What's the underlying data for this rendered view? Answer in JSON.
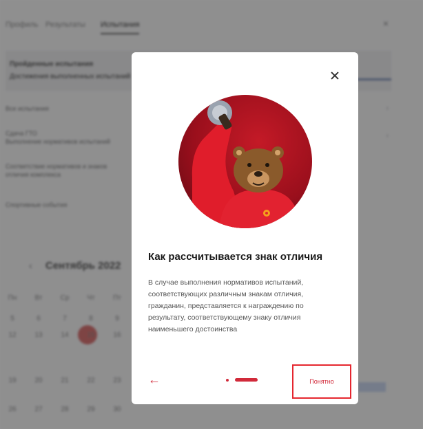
{
  "background": {
    "tabs": [
      "Профиль",
      "Результаты",
      "Испытания"
    ],
    "card_title": "Пройденные испытания",
    "card_subtitle": "Достижения выполненных испытаний",
    "list": [
      "Все испытания",
      "Сдача ГТО\nВыполнение нормативов испытаний",
      "Соответствие нормативов и знаков\nотличия комплекса",
      "Спортивные события"
    ],
    "calendar": {
      "title": "Сентябрь 2022",
      "weekdays": [
        "Пн",
        "Вт",
        "Ср",
        "Чт",
        "Пт"
      ],
      "row1": [
        "5",
        "6",
        "7",
        "8",
        "9"
      ],
      "row2": [
        "12",
        "13",
        "14",
        "15",
        "16"
      ],
      "row3": [
        "19",
        "20",
        "21",
        "22",
        "23"
      ],
      "row4": [
        "26",
        "27",
        "28",
        "29",
        "30"
      ]
    }
  },
  "modal": {
    "title": "Как рассчитывается знак отличия",
    "body": "В случае выполнения нормативов испытаний, соответствующих различным знакам отличия, гражданин, представляется к награждению по результату, соответствующему знаку отличия наименьшего достоинства",
    "ok_label": "Понятно",
    "back_symbol": "←",
    "close_symbol": "×",
    "pagination": {
      "total": 2,
      "current": 2
    }
  },
  "colors": {
    "accent": "#d12a3a",
    "highlight_border": "#e5262f",
    "illustration_bg": "#b0141f"
  },
  "icons": {
    "close": "close-icon",
    "back": "arrow-left-icon",
    "illustration": "bear-mascot-icon"
  }
}
